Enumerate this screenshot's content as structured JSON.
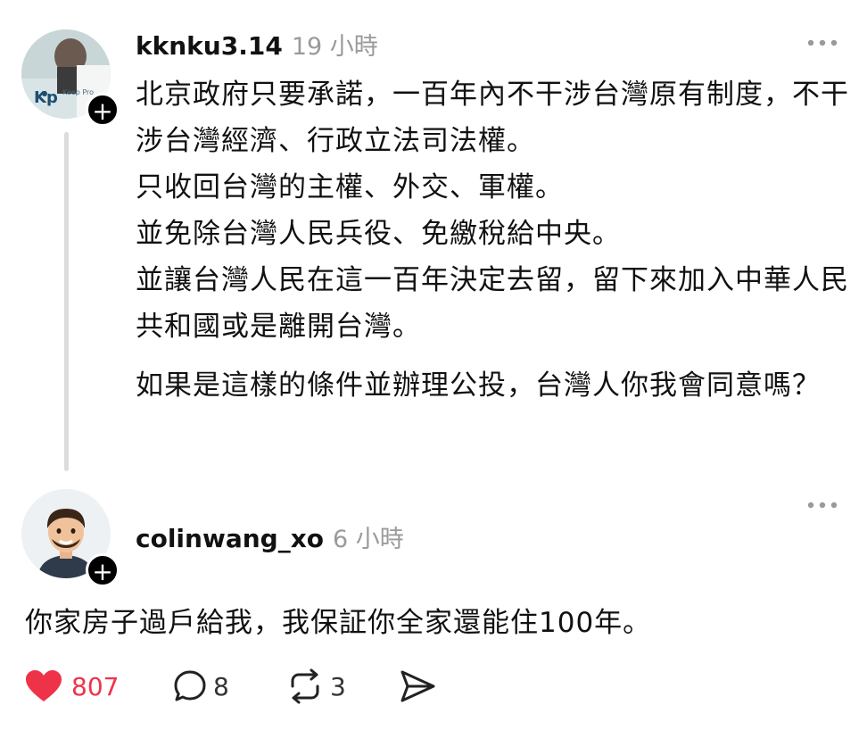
{
  "post": {
    "username": "kknku3.14",
    "time": "19 小時",
    "avatar_logo": "Kp",
    "avatar_logo_text": "Keep Pro",
    "paragraphs": [
      "北京政府只要承諾，一百年內不干涉台灣原有制度，不干涉台灣經濟、行政立法司法權。",
      "只收回台灣的主權、外交、軍權。",
      "並免除台灣人民兵役、免繳稅給中央。",
      "並讓台灣人民在這一百年決定去留，留下來加入中華人民共和國或是離開台灣。",
      "如果是這樣的條件並辦理公投，台灣人你我會同意嗎？"
    ],
    "follow_label": "+",
    "more_icon": "more-horizontal-icon"
  },
  "reply": {
    "username": "colinwang_xo",
    "time": "6 小時",
    "text": "你家房子過戶給我，我保証你全家還能住100年。",
    "follow_label": "+",
    "more_icon": "more-horizontal-icon"
  },
  "actions": {
    "like_count": "807",
    "comment_count": "8",
    "repost_count": "3",
    "like_color": "#ee3349"
  }
}
